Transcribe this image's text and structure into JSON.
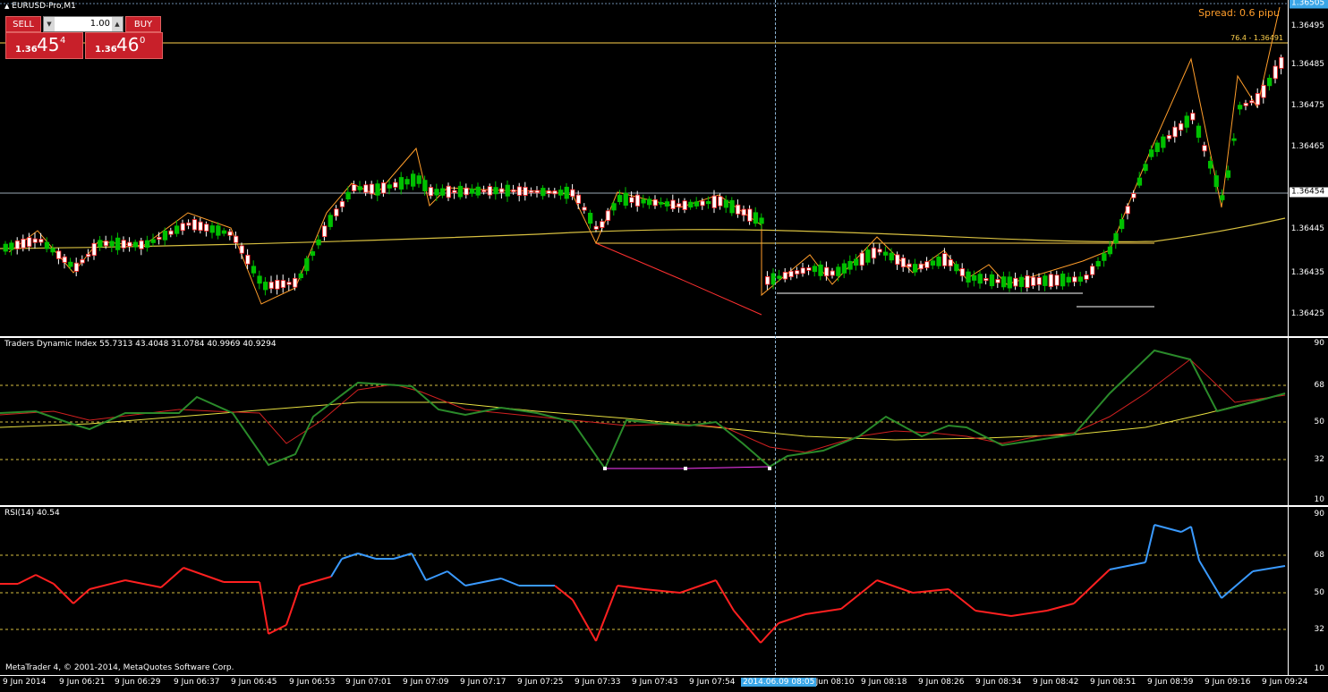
{
  "window": {
    "symbol_title": "EURUSD-Pro,M1",
    "menu_icon": "triangle-up-icon"
  },
  "trade_panel": {
    "sell_label": "SELL",
    "buy_label": "BUY",
    "lot_value": "1.00",
    "sell_price": {
      "prefix": "1.36",
      "big": "45",
      "sup": "4"
    },
    "buy_price": {
      "prefix": "1.36",
      "big": "46",
      "sup": "0"
    }
  },
  "main_chart": {
    "spread_text": "Spread: 0.6 pipu",
    "fibo_label": "76.4 - 1.36491",
    "price_labels": [
      "1.36505",
      "1.36495",
      "1.36485",
      "1.36475",
      "1.36465",
      "1.36454",
      "1.36445",
      "1.36435",
      "1.36425"
    ],
    "current_price": "1.36454"
  },
  "tdi": {
    "caption": "Traders Dynamic Index 55.7313 43.4048 31.0784 40.9969 40.9294",
    "levels": [
      "90",
      "68",
      "50",
      "32",
      "10"
    ]
  },
  "rsi": {
    "caption": "RSI(14) 40.54",
    "levels": [
      "90",
      "68",
      "50",
      "32",
      "10"
    ],
    "copyright": "MetaTrader 4, © 2001-2014, MetaQuotes Software Corp."
  },
  "time_axis": {
    "labels": [
      "9 Jun 2014",
      "9 Jun 06:21",
      "9 Jun 06:29",
      "9 Jun 06:37",
      "9 Jun 06:45",
      "9 Jun 06:53",
      "9 Jun 07:01",
      "9 Jun 07:09",
      "9 Jun 07:17",
      "9 Jun 07:25",
      "9 Jun 07:33",
      "9 Jun 07:43",
      "9 Jun 07:54",
      "9 Jun 08:10",
      "9 Jun 08:18",
      "9 Jun 08:26",
      "9 Jun 08:34",
      "9 Jun 08:42",
      "9 Jun 08:51",
      "9 Jun 08:59",
      "9 Jun 09:16",
      "9 Jun 09:24"
    ],
    "crosshair_label": "2014.06.09 08:05"
  },
  "colors": {
    "bull": "#00c000",
    "bear": "#ffffff",
    "bear_edge": "#ff2020",
    "ma": "#d8c040",
    "zigzag": "#ff9d2a",
    "tdi_green": "#2a8a2a",
    "tdi_red": "#d02020",
    "tdi_yellow": "#e8e040",
    "rsi_red": "#ff2020",
    "rsi_blue": "#3a9aff"
  }
}
